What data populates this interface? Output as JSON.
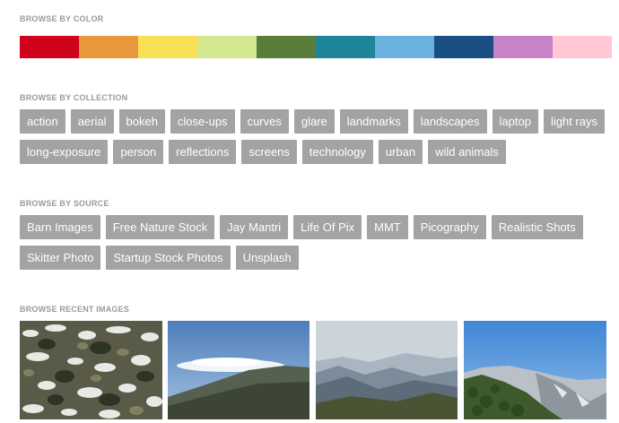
{
  "sections": {
    "color": {
      "title": "BROWSE BY COLOR"
    },
    "collection": {
      "title": "BROWSE BY COLLECTION"
    },
    "source": {
      "title": "BROWSE BY SOURCE"
    },
    "recent": {
      "title": "BROWSE RECENT IMAGES"
    }
  },
  "colors": [
    "#d0021b",
    "#e8973a",
    "#f9df55",
    "#d4e88f",
    "#5b7d3c",
    "#1e8598",
    "#6cb2e0",
    "#1a4f84",
    "#c783c5",
    "#ffc8d4"
  ],
  "collections": [
    "action",
    "aerial",
    "bokeh",
    "close-ups",
    "curves",
    "glare",
    "landmarks",
    "landscapes",
    "laptop",
    "light rays",
    "long-exposure",
    "person",
    "reflections",
    "screens",
    "technology",
    "urban",
    "wild animals"
  ],
  "sources": [
    "Barn Images",
    "Free Nature Stock",
    "Jay Mantri",
    "Life Of Pix",
    "MMT",
    "Picography",
    "Realistic Shots",
    "Skitter Photo",
    "Startup Stock Photos",
    "Unsplash"
  ],
  "recent_images": [
    "rocks-snow-image",
    "mountain-cloud-image",
    "hazy-mountains-image",
    "forested-peak-image"
  ]
}
